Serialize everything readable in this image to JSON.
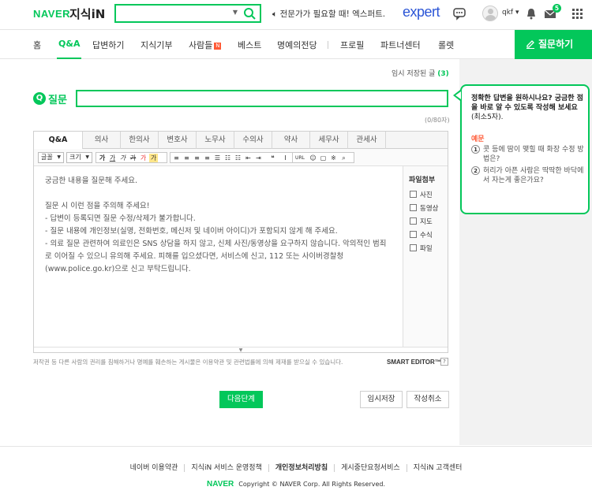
{
  "header": {
    "logo_naver": "NAVER",
    "logo_jisik": "지식iN",
    "promo_text": "전문가가 필요할 때! 엑스퍼트.",
    "expert_logo": "expert",
    "user_name": "qkf",
    "notification_count": "5"
  },
  "nav": {
    "items": [
      "홈",
      "Q&A",
      "답변하기",
      "지식기부",
      "사람들",
      "베스트",
      "명예의전당",
      "프로필",
      "파트너센터",
      "롤렛"
    ],
    "new_badge": "N",
    "ask_button": "질문하기"
  },
  "draft": {
    "label": "임시 저장된 글",
    "count": "(3)"
  },
  "question": {
    "badge": "Q",
    "label": "질문",
    "title_value": "",
    "char_counter": "(0/80자)"
  },
  "editor": {
    "tabs": [
      "Q&A",
      "의사",
      "한의사",
      "변호사",
      "노무사",
      "수의사",
      "약사",
      "세무사",
      "관세사"
    ],
    "font_select": "글꼴",
    "size_select": "크기",
    "body": "궁금한 내용을 질문해 주세요.\n\n질문 시 이런 점을 주의해 주세요!\n- 답변이 등록되면 질문 수정/삭제가 불가합니다.\n- 질문 내용에 개인정보(실명, 전화번호, 메신저 및 네이버 아이디)가 포함되지 않게 해 주세요.\n- 의료 질문 관련하여 의료인은 SNS 상담을 하지 않고, 신체 사진/동영상을 요구하지 않습니다. 악의적인 범죄로 이어질 수 있으니 유의해 주세요. 피해를 입으셨다면, 서비스에 신고, 112 또는 사이버경찰청(www.police.go.kr)으로 신고 부탁드립니다.",
    "attach_title": "파일첨부",
    "attach_items": [
      "사진",
      "동영상",
      "지도",
      "수식",
      "파일"
    ]
  },
  "notice": "저작권 등 다른 사람의 권리를 침해하거나 명예를 훼손하는 게시물은 이용약관 및 관련법률에 의해 제재를 받으실 수 있습니다.",
  "smart_editor": "SMART EDITOR™",
  "buttons": {
    "next": "다음단계",
    "save": "임시저장",
    "cancel": "작성취소"
  },
  "tip": {
    "headline": "정확한 답변을 원하시나요? 궁금한 점을 바로 알 수 있도록 작성해 보세요",
    "headline_note": "(최소5자).",
    "example_label": "예문",
    "examples": [
      "콧 등에 땀이 맺힐 때 화장 수정 방법은?",
      "허리가 아픈 사람은 딱딱한 바닥에서 자는게 좋은가요?"
    ]
  },
  "footer": {
    "links": [
      "네이버 이용약관",
      "지식iN 서비스 운영정책",
      "개인정보처리방침",
      "게시중단요청서비스",
      "지식iN 고객센터"
    ],
    "naver": "NAVER",
    "copyright": "Copyright © NAVER Corp. All Rights Reserved."
  },
  "colors": {
    "brand": "#03c75a",
    "expert": "#2b55d6",
    "alert": "#ff5a36"
  }
}
